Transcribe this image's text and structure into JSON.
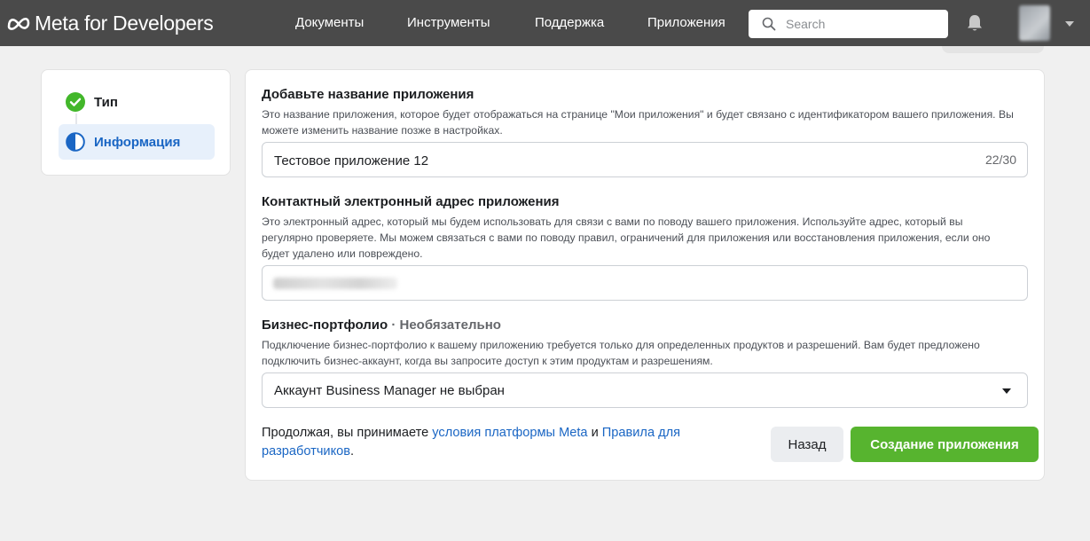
{
  "header": {
    "logo_text": "Meta for Developers",
    "nav": [
      {
        "label": "Документы"
      },
      {
        "label": "Инструменты"
      },
      {
        "label": "Поддержка"
      },
      {
        "label": "Приложения"
      }
    ],
    "search_placeholder": "Search"
  },
  "steps": [
    {
      "label": "Тип",
      "status": "complete"
    },
    {
      "label": "Информация",
      "status": "current"
    }
  ],
  "form": {
    "app_name": {
      "title": "Добавьте название приложения",
      "description": "Это название приложения, которое будет отображаться на странице \"Мои приложения\" и будет связано с идентификатором вашего приложения. Вы можете изменить название позже в настройках.",
      "value": "Тестовое приложение 12",
      "counter": "22/30"
    },
    "contact_email": {
      "title": "Контактный электронный адрес приложения",
      "description": "Это электронный адрес, который мы будем использовать для связи с вами по поводу вашего приложения. Используйте адрес, который вы регулярно проверяете. Мы можем связаться с вами по поводу правил, ограничений для приложения или восстановления приложения, если оно будет удалено или повреждено."
    },
    "business": {
      "title": "Бизнес-портфолио",
      "optional": "· Необязательно",
      "description": "Подключение бизнес-портфолио к вашему приложению требуется только для определенных продуктов и разрешений. Вам будет предложено подключить бизнес-аккаунт, когда вы запросите доступ к этим продуктам и разрешениям.",
      "selected": "Аккаунт Business Manager не выбран"
    },
    "terms": {
      "prefix": "Продолжая, вы принимаете ",
      "link1": "условия платформы Meta",
      "middle": " и ",
      "link2": "Правила для разработчиков",
      "suffix": "."
    },
    "back_label": "Назад",
    "create_label": "Создание приложения"
  },
  "colors": {
    "topbar": "#4a4a4a",
    "primary_button": "#57b42f",
    "link": "#1a66c4",
    "active_step_bg": "#e7f0fb"
  }
}
